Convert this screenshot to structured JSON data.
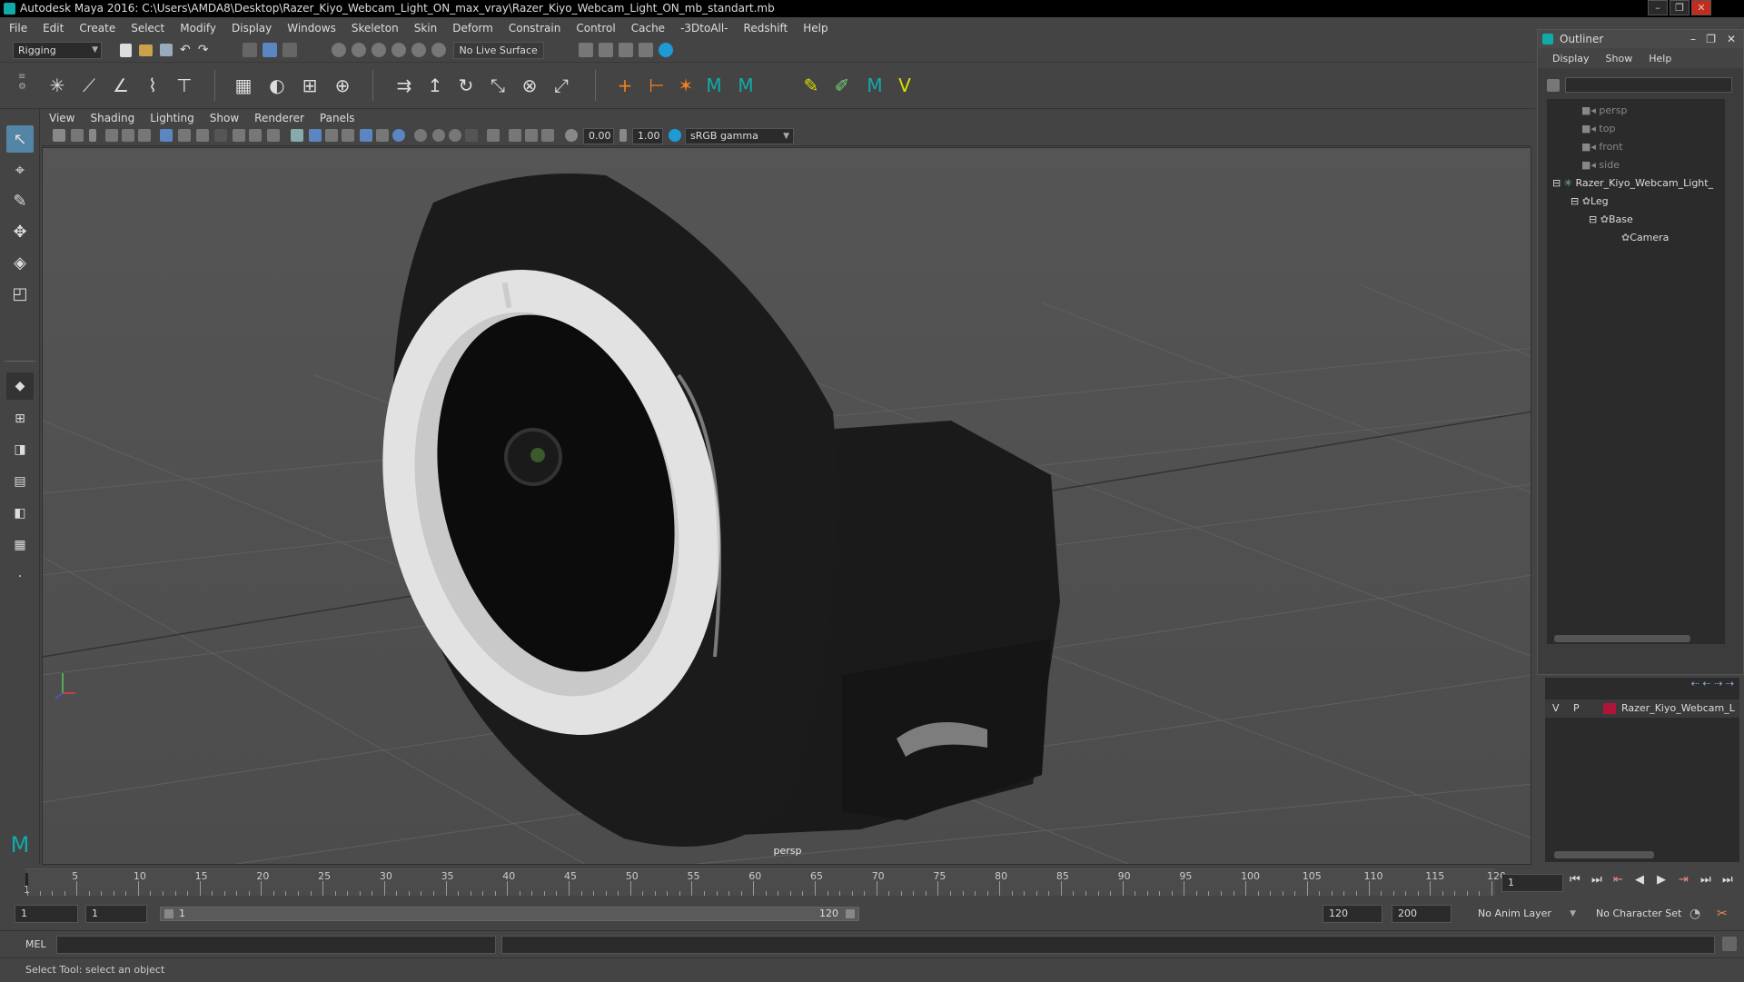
{
  "window": {
    "title": "Autodesk Maya 2016: C:\\Users\\AMDA8\\Desktop\\Razer_Kiyo_Webcam_Light_ON_max_vray\\Razer_Kiyo_Webcam_Light_ON_mb_standart.mb"
  },
  "menubar": [
    "File",
    "Edit",
    "Create",
    "Select",
    "Modify",
    "Display",
    "Windows",
    "Skeleton",
    "Skin",
    "Deform",
    "Constrain",
    "Control",
    "Cache",
    "-3DtoAll-",
    "Redshift",
    "Help"
  ],
  "statusline": {
    "mode": "Rigging",
    "live_surface": "No Live Surface"
  },
  "viewport": {
    "menu": [
      "View",
      "Shading",
      "Lighting",
      "Show",
      "Renderer",
      "Panels"
    ],
    "exposure": "0.00",
    "gamma": "1.00",
    "colorspace": "sRGB gamma",
    "camera": "persp"
  },
  "outliner": {
    "title": "Outliner",
    "menu": [
      "Display",
      "Show",
      "Help"
    ],
    "items": [
      {
        "label": "persp"
      },
      {
        "label": "top"
      },
      {
        "label": "front"
      },
      {
        "label": "side"
      },
      {
        "label": "Razer_Kiyo_Webcam_Light_"
      },
      {
        "label": "Leg"
      },
      {
        "label": "Base"
      },
      {
        "label": "Camera"
      }
    ]
  },
  "layers": {
    "v": "V",
    "p": "P",
    "name": "Razer_Kiyo_Webcam_L",
    "color": "#b0143a"
  },
  "timeline": {
    "ticks": [
      "5",
      "10",
      "15",
      "20",
      "25",
      "30",
      "35",
      "40",
      "45",
      "50",
      "55",
      "60",
      "65",
      "70",
      "75",
      "80",
      "85",
      "90",
      "95",
      "100",
      "105",
      "110",
      "115",
      "120"
    ],
    "start_label": "1",
    "current_frame": "1"
  },
  "range": {
    "start": "1",
    "anim_start": "1",
    "slider_start": "1",
    "slider_end": "120",
    "end": "120",
    "anim_end": "200",
    "anim_layer": "No Anim Layer",
    "char_set": "No Character Set"
  },
  "command": {
    "lang": "MEL"
  },
  "help": "Select Tool: select an object"
}
